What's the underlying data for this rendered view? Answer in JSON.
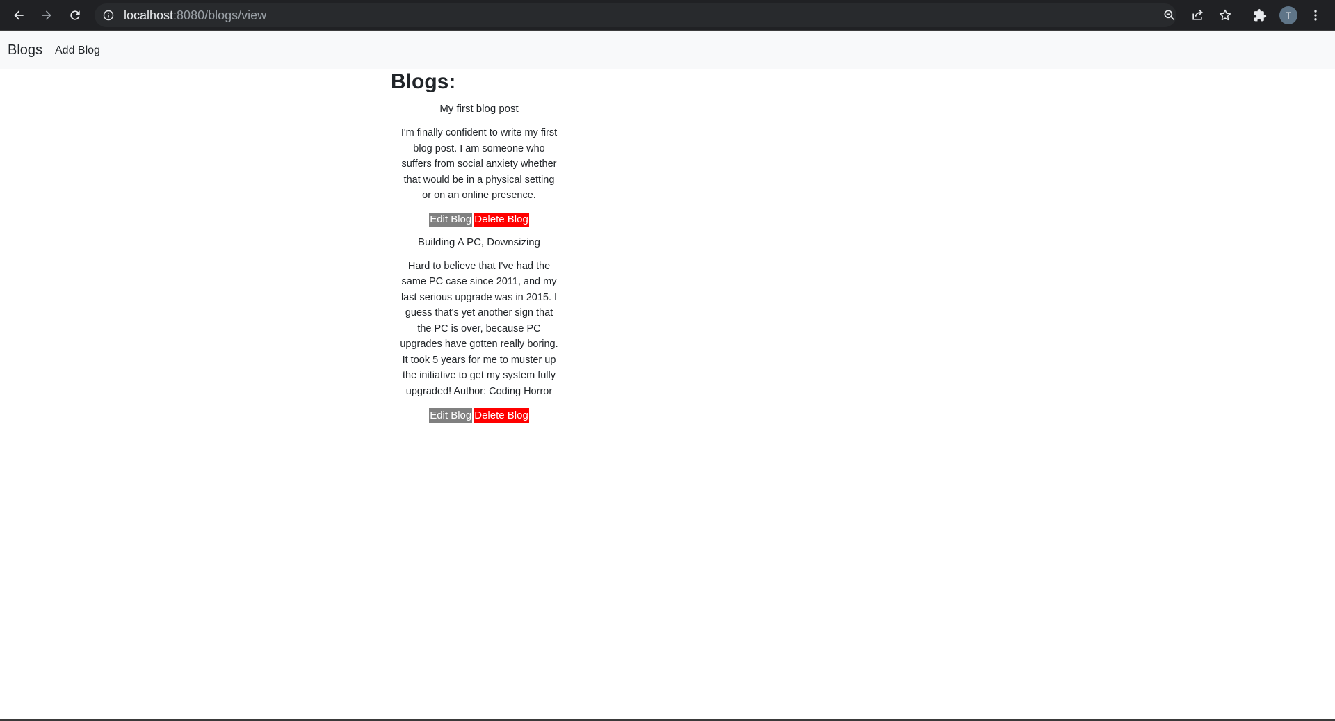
{
  "browser": {
    "url_host": "localhost",
    "url_rest": ":8080/blogs/view",
    "profile_initial": "T"
  },
  "navbar": {
    "brand": "Blogs",
    "add_blog": "Add Blog"
  },
  "page": {
    "heading": "Blogs:"
  },
  "blogs": [
    {
      "title": "My first blog post",
      "body": "I'm finally confident to write my first blog post. I am someone who suffers from social anxiety whether that would be in a physical setting or on an online presence.",
      "edit_label": "Edit Blog",
      "delete_label": "Delete Blog"
    },
    {
      "title": "Building A PC, Downsizing",
      "body": "Hard to believe that I've had the same PC case since 2011, and my last serious upgrade was in 2015. I guess that's yet another sign that the PC is over, because PC upgrades have gotten really boring. It took 5 years for me to muster up the initiative to get my system fully upgraded! Author: Coding Horror",
      "edit_label": "Edit Blog",
      "delete_label": "Delete Blog"
    }
  ],
  "colors": {
    "edit_button": "#808080",
    "delete_button": "#ff0000",
    "navbar_bg": "#f8f9fa",
    "browser_bar_bg": "#202124"
  }
}
